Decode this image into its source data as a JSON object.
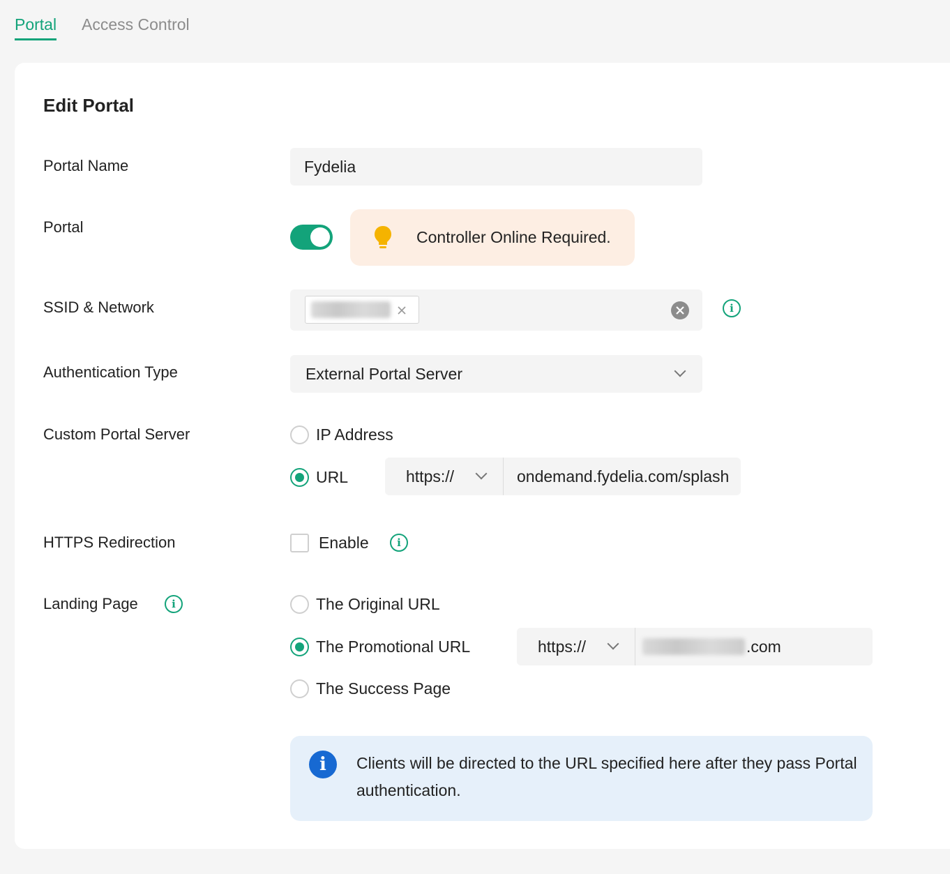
{
  "tabs": [
    {
      "label": "Portal",
      "active": true
    },
    {
      "label": "Access Control",
      "active": false
    }
  ],
  "accent_color": "#13a37a",
  "form": {
    "title": "Edit Portal",
    "portal_name": {
      "label": "Portal Name",
      "value": "Fydelia"
    },
    "portal": {
      "label": "Portal",
      "enabled": true,
      "notice": "Controller Online Required.",
      "notice_icon": "lightbulb-icon"
    },
    "ssid_network": {
      "label": "SSID & Network",
      "chip_remove_icon": "close-icon",
      "clear_icon": "clear-circle-icon",
      "info_icon": "info-icon"
    },
    "authentication_type": {
      "label": "Authentication Type",
      "value": "External Portal Server"
    },
    "custom_portal_server": {
      "label": "Custom Portal Server",
      "options": [
        {
          "label": "IP Address",
          "selected": false
        },
        {
          "label": "URL",
          "selected": true
        }
      ],
      "protocol": "https://",
      "url_value": "ondemand.fydelia.com/splash"
    },
    "https_redirection": {
      "label": "HTTPS Redirection",
      "checkbox_label": "Enable",
      "checked": false
    },
    "landing_page": {
      "label": "Landing Page",
      "options": [
        {
          "label": "The Original URL",
          "selected": false
        },
        {
          "label": "The Promotional URL",
          "selected": true
        },
        {
          "label": "The Success Page",
          "selected": false
        }
      ],
      "protocol": "https://",
      "url_suffix": ".com",
      "info_text": "Clients will be directed to the URL specified here after they pass Portal authentication."
    }
  }
}
